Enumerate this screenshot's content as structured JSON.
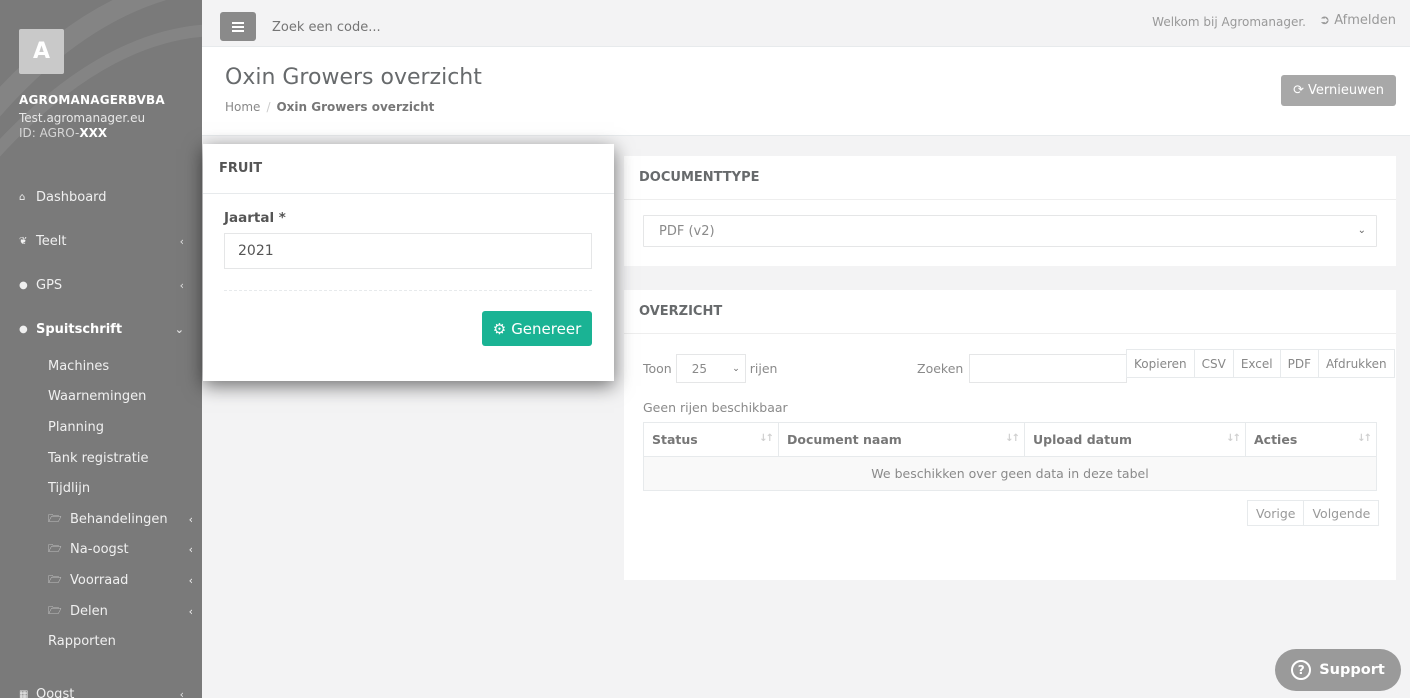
{
  "sidebar": {
    "avatar_letter": "A",
    "company": "AGROMANAGERBVBA",
    "site": "Test.agromanager.eu",
    "id_prefix": "ID: AGRO-",
    "id_value": "XXX",
    "nav": {
      "dashboard": "Dashboard",
      "teelt": "Teelt",
      "gps": "GPS",
      "spuitschrift": "Spuitschrift",
      "oogst": "Oogst"
    },
    "sub": {
      "machines": "Machines",
      "waarnemingen": "Waarnemingen",
      "planning": "Planning",
      "tank": "Tank registratie",
      "tijdlijn": "Tijdlijn",
      "behandelingen": "Behandelingen",
      "na_oogst": "Na-oogst",
      "voorraad": "Voorraad",
      "delen": "Delen",
      "rapporten": "Rapporten"
    }
  },
  "topbar": {
    "search_placeholder": "Zoek een code...",
    "welcome": "Welkom bij Agromanager.",
    "logout": "Afmelden"
  },
  "header": {
    "title": "Oxin Growers overzicht",
    "breadcrumb_home": "Home",
    "breadcrumb_current": "Oxin Growers overzicht",
    "refresh": "Vernieuwen"
  },
  "doctype": {
    "title": "DOCUMENTTYPE",
    "selected": "PDF (v2)"
  },
  "overview": {
    "title": "OVERZICHT",
    "toon": "Toon",
    "page_length": "25",
    "rijen": "rijen",
    "zoeken": "Zoeken",
    "buttons": [
      "Kopieren",
      "CSV",
      "Excel",
      "PDF",
      "Afdrukken"
    ],
    "info": "Geen rijen beschikbaar",
    "columns": [
      "Status",
      "Document naam",
      "Upload datum",
      "Acties"
    ],
    "empty": "We beschikken over geen data in deze tabel",
    "prev": "Vorige",
    "next": "Volgende"
  },
  "modal": {
    "title": "FRUIT",
    "label": "Jaartal *",
    "value": "2021",
    "button": "Genereer"
  },
  "support": "Support",
  "colors": {
    "sidebar": "#7a7a7a",
    "accent": "#1ab394"
  }
}
